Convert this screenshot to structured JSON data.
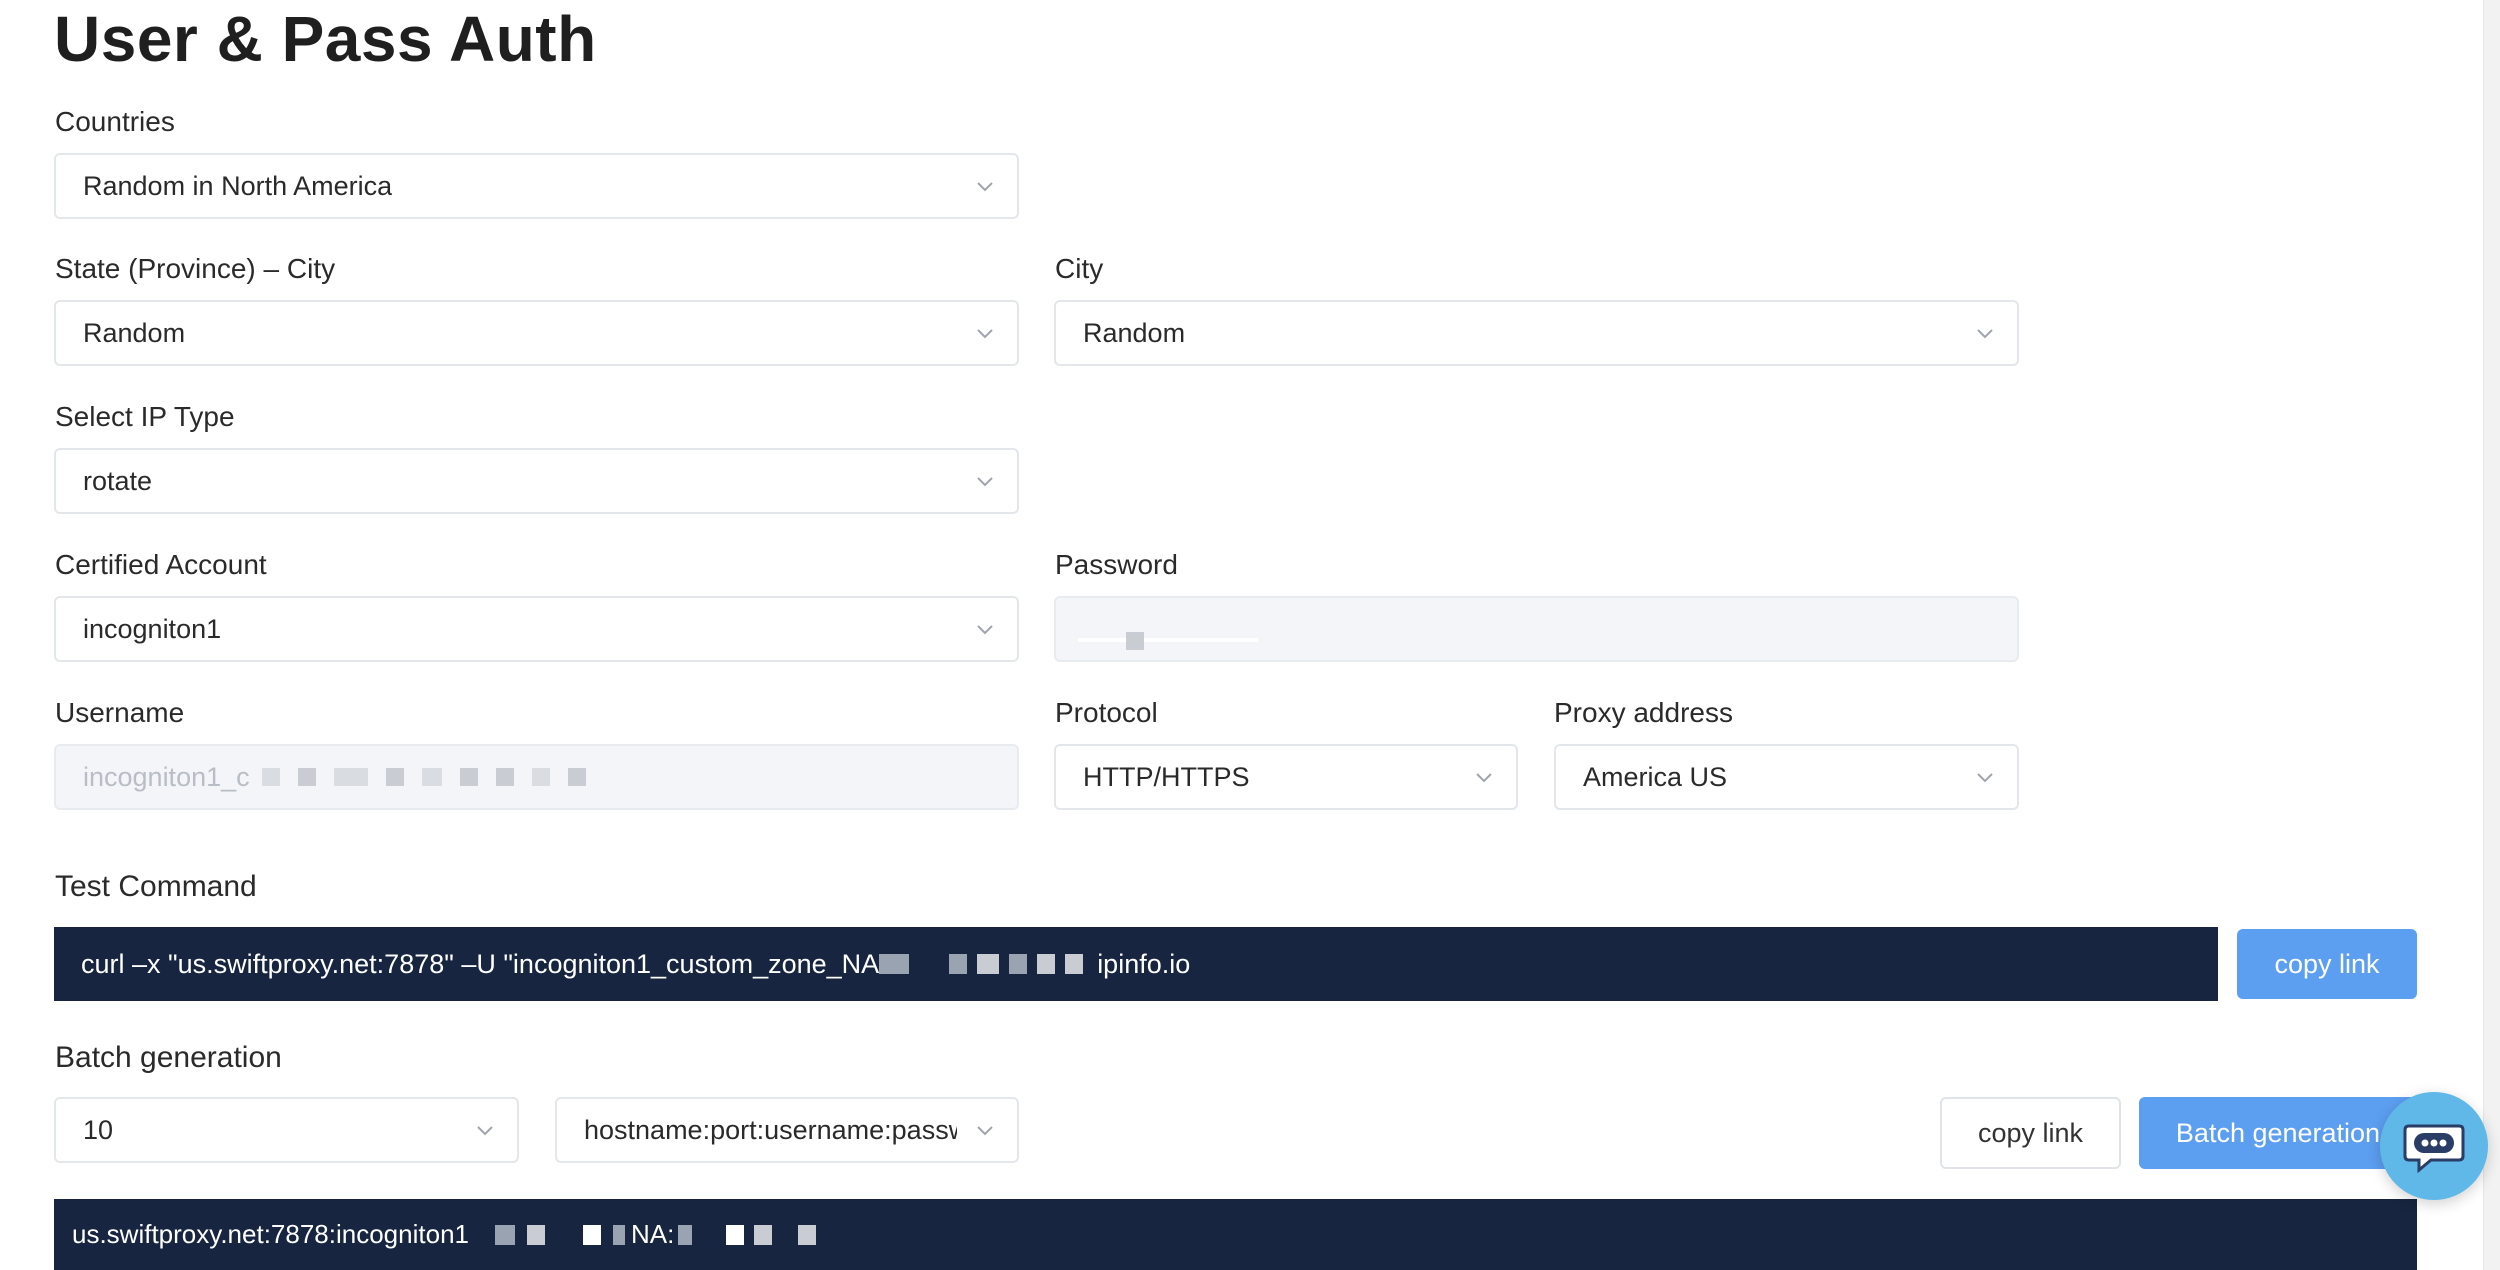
{
  "page": {
    "title": "User & Pass Auth"
  },
  "form": {
    "countries": {
      "label": "Countries",
      "value": "Random in North America"
    },
    "state_city": {
      "label": "State (Province) – City",
      "value": "Random"
    },
    "city": {
      "label": "City",
      "value": "Random"
    },
    "ip_type": {
      "label": "Select IP Type",
      "value": "rotate"
    },
    "account": {
      "label": "Certified Account",
      "value": "incogniton1"
    },
    "password": {
      "label": "Password",
      "value": ""
    },
    "username": {
      "label": "Username",
      "value": "incogniton1_c"
    },
    "protocol": {
      "label": "Protocol",
      "value": "HTTP/HTTPS"
    },
    "proxy_address": {
      "label": "Proxy address",
      "value": "America US"
    }
  },
  "test_command": {
    "label": "Test Command",
    "prefix": "curl –x \"us.swiftproxy.net:7878\" –U \"incogniton1_custom_zone_NA",
    "suffix": "ipinfo.io",
    "copy_label": "copy link"
  },
  "batch": {
    "label": "Batch generation",
    "count": "10",
    "format": "hostname:port:username:password",
    "copy_label": "copy link",
    "generate_label": "Batch generation",
    "output_prefix": "us.swiftproxy.net:7878:incogniton1",
    "output_mid": "NA:"
  },
  "icons": {
    "chevron": "chevron-down-icon",
    "chat": "chat-bot-icon"
  },
  "colors": {
    "primary": "#5c9ef0",
    "dark_bar": "#172540",
    "chat": "#5fb8e8"
  }
}
